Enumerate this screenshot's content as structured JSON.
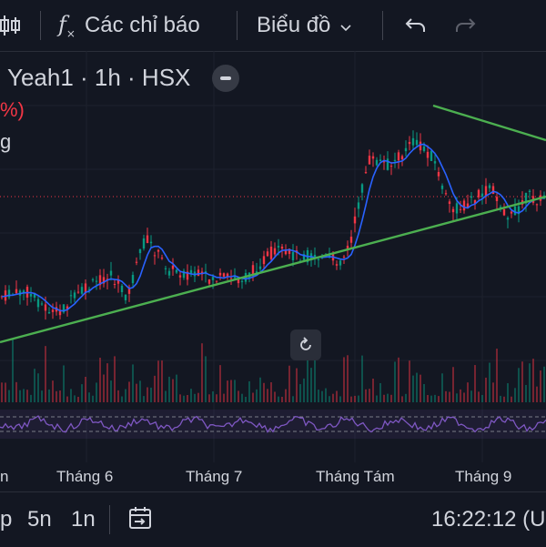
{
  "toolbar": {
    "indicators_label": "Các chỉ báo",
    "chart_label": "Biểu đồ",
    "icons": [
      "candles-icon",
      "fx-icon",
      "chevron-down-icon",
      "undo-icon",
      "redo-icon"
    ]
  },
  "legend": {
    "symbol": "Yeah1 · 1h · HSX",
    "change_fragment": "%)",
    "volume_fragment": "g"
  },
  "axis": {
    "months": [
      "n",
      "Tháng 6",
      "Tháng 7",
      "Tháng Tám",
      "Tháng 9"
    ]
  },
  "bottom": {
    "ranges": [
      "p",
      "5n",
      "1n"
    ],
    "time": "16:22:12 (U"
  },
  "colors": {
    "background": "#131722",
    "up": "#089981",
    "down": "#f23645",
    "ma": "#2962ff",
    "trendline": "#4caf50",
    "rsi": "#7e57c2"
  }
}
